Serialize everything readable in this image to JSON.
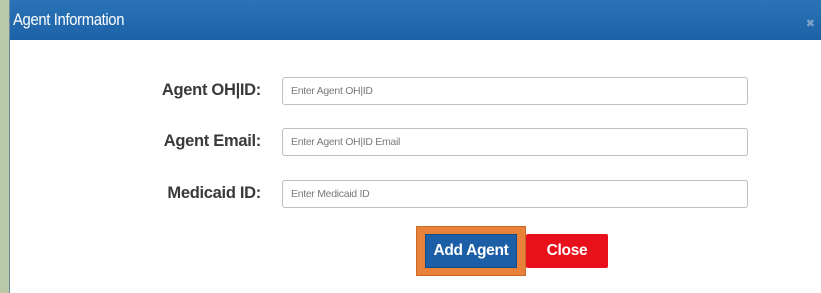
{
  "dialog": {
    "title": "Agent Information",
    "close_icon": "✖"
  },
  "form": {
    "fields": [
      {
        "label": "Agent OH|ID:",
        "placeholder": "Enter Agent OH|ID",
        "value": ""
      },
      {
        "label": "Agent Email:",
        "placeholder": "Enter Agent OH|ID Email",
        "value": ""
      },
      {
        "label": "Medicaid ID:",
        "placeholder": "Enter Medicaid ID",
        "value": ""
      }
    ]
  },
  "actions": {
    "add_label": "Add Agent",
    "close_label": "Close"
  },
  "colors": {
    "titlebar": "#1c62a6",
    "add_button": "#1c5fa6",
    "close_button": "#e8101a",
    "highlight": "#e8823a",
    "backdrop": "#b9c9a8"
  }
}
